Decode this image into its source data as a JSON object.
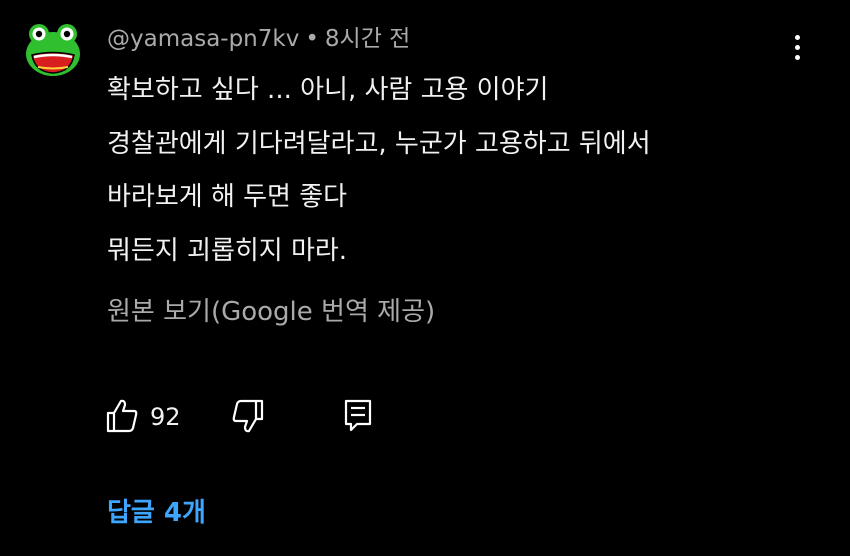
{
  "comment": {
    "author": "@yamasa-pn7kv",
    "separator": "•",
    "time": "8시간 전",
    "lines": [
      "확보하고 싶다 ... 아니, 사람 고용 이야기",
      "경찰관에게 기다려달라고, 누군가 고용하고 뒤에서",
      "바라보게 해 두면 좋다",
      "뭐든지 괴롭히지 마라."
    ],
    "translate_link": "원본 보기(Google 번역 제공)",
    "like_count": "92",
    "replies_label": "답글 4개"
  },
  "icons": {
    "avatar": "frog-avatar",
    "menu": "more-vert-icon",
    "like": "thumb-up-icon",
    "dislike": "thumb-down-icon",
    "reply": "reply-comment-icon"
  },
  "colors": {
    "background": "#000000",
    "text": "#f1f1f1",
    "secondary": "#aaaaaa",
    "link": "#3ea6ff",
    "avatar_green": "#2fbf2f",
    "avatar_mouth": "#d81e1e"
  }
}
